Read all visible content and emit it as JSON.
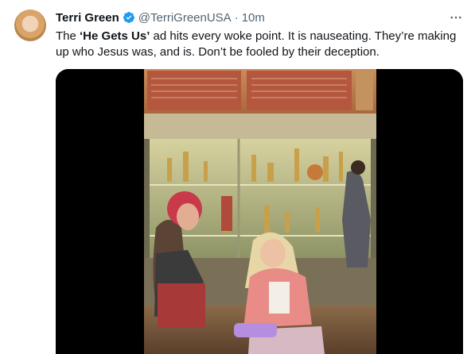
{
  "tweet": {
    "author_name": "Terri Green",
    "handle": "@TerriGreenUSA",
    "separator": "·",
    "time": "10m",
    "text_before": "The ",
    "text_bold": "‘He Gets Us’",
    "text_after": " ad hits every woke point. It is nauseating. They’re making up who Jesus was, and is. Don’t be fooled by their deception."
  },
  "colors": {
    "verified": "#1d9bf0",
    "secondary_text": "#536471",
    "primary_text": "#0f1419"
  },
  "icons": {
    "verified": "verified-badge-icon",
    "more": "more-horizontal-icon"
  }
}
